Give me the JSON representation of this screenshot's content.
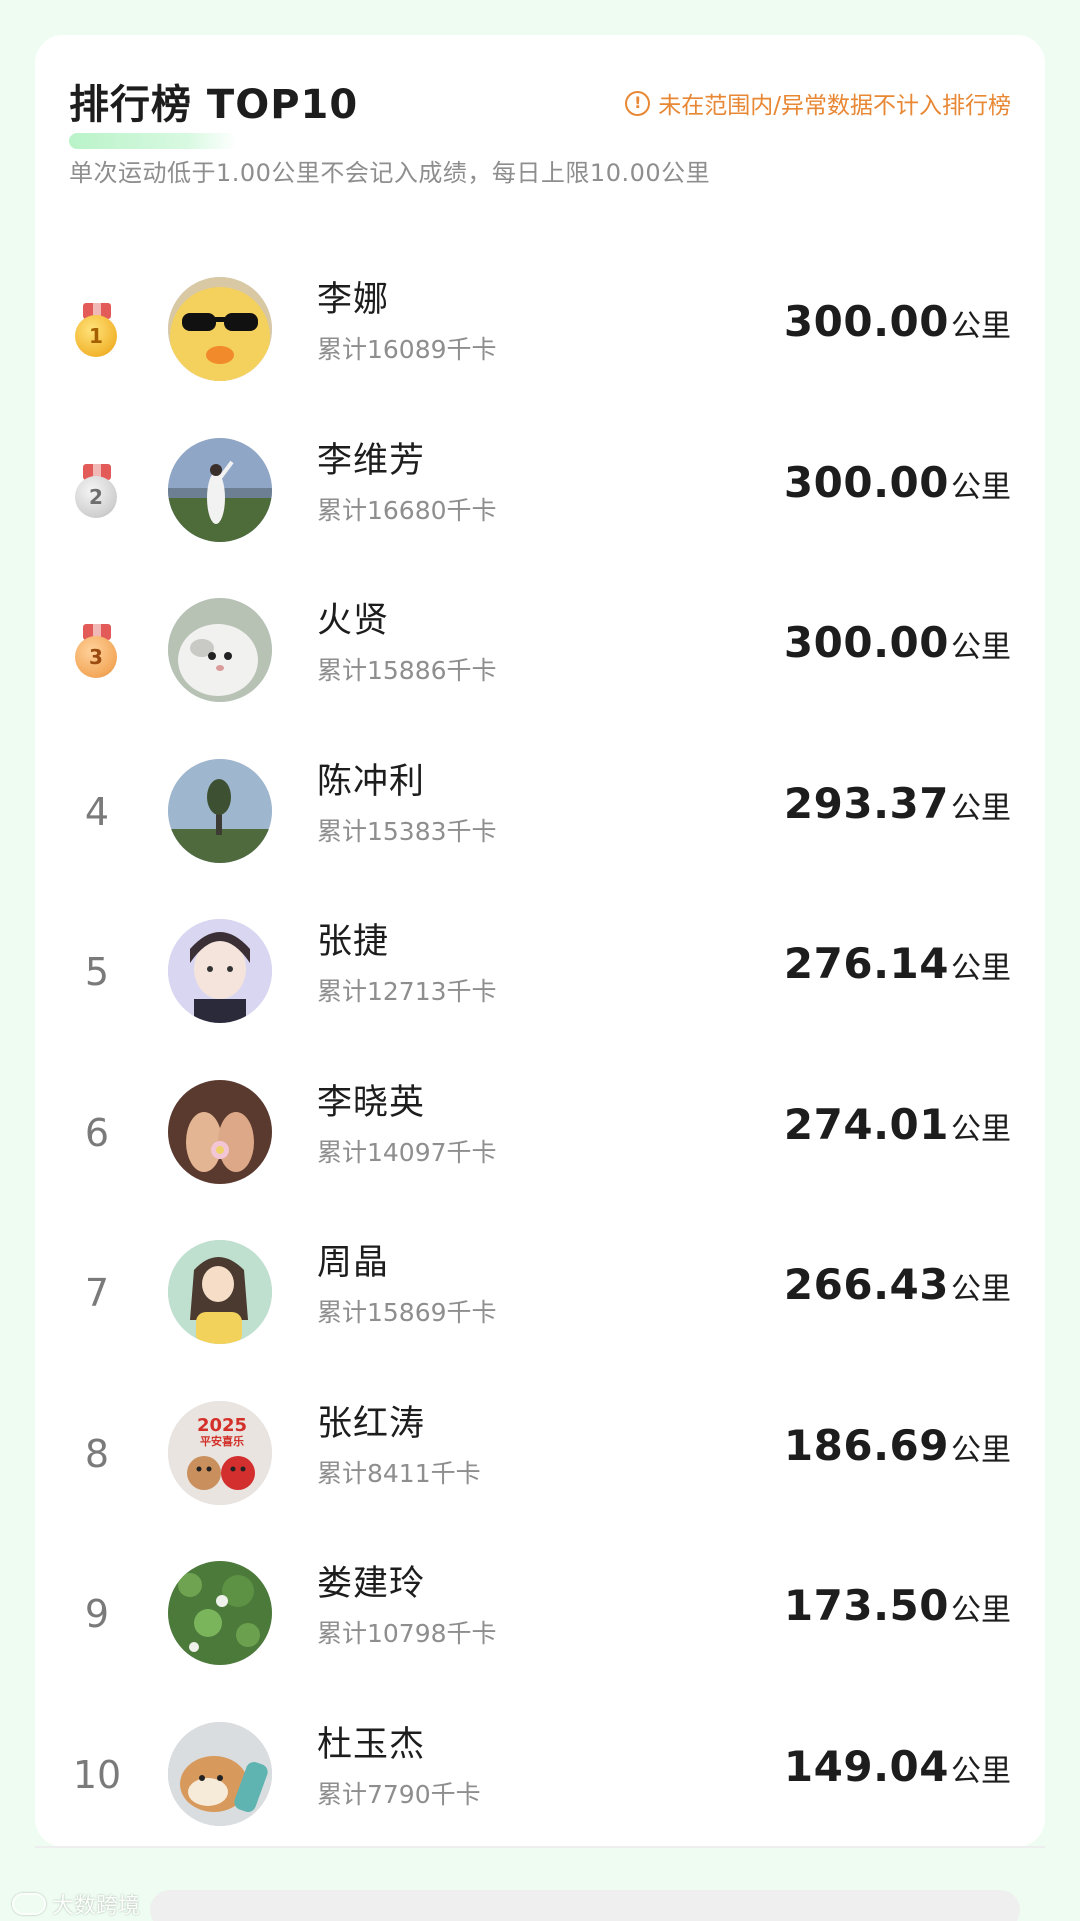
{
  "header": {
    "title": "排行榜 TOP10",
    "notice": "未在范围内/异常数据不计入排行榜",
    "notice_icon": "exclamation-circle-icon",
    "subtitle": "单次运动低于1.00公里不会记入成绩，每日上限10.00公里"
  },
  "colors": {
    "page_bg": "#eefcf1",
    "card_bg": "#ffffff",
    "notice": "#e88734",
    "title_highlight": "#b9f3c8",
    "primary_text": "#1d1d1d",
    "secondary_text": "#8e8e8e"
  },
  "ranking": [
    {
      "rank": "1",
      "medal": "gold-medal-icon",
      "name": "李娜",
      "kcal": "累计16089千卡",
      "distance": "300.00",
      "unit": "公里",
      "avatar": "duck-with-sunglasses"
    },
    {
      "rank": "2",
      "medal": "silver-medal-icon",
      "name": "李维芳",
      "kcal": "累计16680千卡",
      "distance": "300.00",
      "unit": "公里",
      "avatar": "person-in-field"
    },
    {
      "rank": "3",
      "medal": "bronze-medal-icon",
      "name": "火贤",
      "kcal": "累计15886千卡",
      "distance": "300.00",
      "unit": "公里",
      "avatar": "white-cat"
    },
    {
      "rank": "4",
      "medal": "",
      "name": "陈冲利",
      "kcal": "累计15383千卡",
      "distance": "293.37",
      "unit": "公里",
      "avatar": "tree-landscape"
    },
    {
      "rank": "5",
      "medal": "",
      "name": "张捷",
      "kcal": "累计12713千卡",
      "distance": "276.14",
      "unit": "公里",
      "avatar": "selfie-portrait"
    },
    {
      "rank": "6",
      "medal": "",
      "name": "李晓英",
      "kcal": "累计14097千卡",
      "distance": "274.01",
      "unit": "公里",
      "avatar": "hands-with-flower"
    },
    {
      "rank": "7",
      "medal": "",
      "name": "周晶",
      "kcal": "累计15869千卡",
      "distance": "266.43",
      "unit": "公里",
      "avatar": "illustrated-girl"
    },
    {
      "rank": "8",
      "medal": "",
      "name": "张红涛",
      "kcal": "累计8411千卡",
      "distance": "186.69",
      "unit": "公里",
      "avatar": "new-year-toys",
      "avatar_text_1": "2025",
      "avatar_text_2": "平安喜乐"
    },
    {
      "rank": "9",
      "medal": "",
      "name": "娄建玲",
      "kcal": "累计10798千卡",
      "distance": "173.50",
      "unit": "公里",
      "avatar": "green-leaves"
    },
    {
      "rank": "10",
      "medal": "",
      "name": "杜玉杰",
      "kcal": "累计7790千卡",
      "distance": "149.04",
      "unit": "公里",
      "avatar": "shiba-dog"
    }
  ],
  "watermark": {
    "text": "大数跨境",
    "logo_icon": "watermark-logo-icon"
  }
}
